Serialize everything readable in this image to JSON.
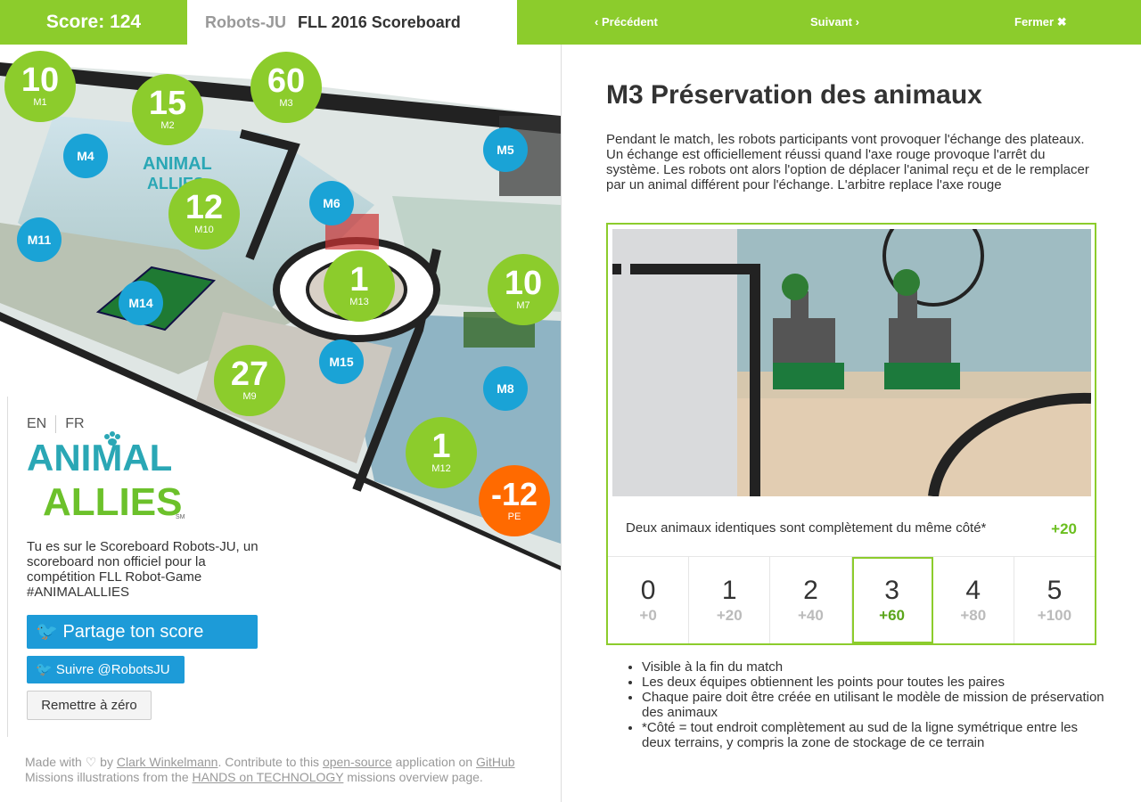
{
  "topbar": {
    "score": "Score: 124",
    "team": "Robots-JU",
    "title": "FLL 2016 Scoreboard",
    "prev": "Précédent",
    "next": "Suivant",
    "close": "Fermer"
  },
  "board": {
    "missions": [
      {
        "id": "M1",
        "value": "10",
        "state": "done"
      },
      {
        "id": "M2",
        "value": "15",
        "state": "done"
      },
      {
        "id": "M3",
        "value": "60",
        "state": "done"
      },
      {
        "id": "M4",
        "state": "todo"
      },
      {
        "id": "M5",
        "state": "todo"
      },
      {
        "id": "M6",
        "state": "todo"
      },
      {
        "id": "M7",
        "value": "10",
        "state": "done"
      },
      {
        "id": "M8",
        "state": "todo"
      },
      {
        "id": "M9",
        "value": "27",
        "state": "done"
      },
      {
        "id": "M10",
        "value": "12",
        "state": "done"
      },
      {
        "id": "M11",
        "state": "todo"
      },
      {
        "id": "M12",
        "value": "1",
        "state": "done"
      },
      {
        "id": "M13",
        "value": "1",
        "state": "done"
      },
      {
        "id": "M14",
        "state": "todo"
      },
      {
        "id": "M15",
        "state": "todo"
      },
      {
        "id": "PE",
        "value": "-12",
        "state": "penalty"
      }
    ]
  },
  "sidebar": {
    "lang_en": "EN",
    "lang_fr": "FR",
    "logo_line1": "ANIMAL",
    "logo_line2": "ALLIES",
    "logo_mark": "SM",
    "intro": "Tu es sur le Scoreboard Robots-JU, un scoreboard non officiel pour la compétition FLL Robot-Game #ANIMALALLIES",
    "share": "Partage ton score",
    "follow": "Suivre @RobotsJU",
    "reset": "Remettre à zéro"
  },
  "footer": {
    "made_with": "Made with",
    "by": "by",
    "author": "Clark Winkelmann",
    "contrib": ". Contribute to this",
    "opensource": "open-source",
    "application_on": "application on",
    "github": "GitHub",
    "missions_from": "Missions illustrations from the",
    "hands": "HANDS on TECHNOLOGY",
    "overview": "missions overview page."
  },
  "mission": {
    "title": "M3 Préservation des animaux",
    "description": "Pendant le match, les robots participants vont provoquer l'échange des plateaux. Un échange est officiellement réussi quand l'axe rouge provoque l'arrêt du système. Les robots ont alors l'option de déplacer l'animal reçu et de le remplacer par un animal différent pour l'échange. L'arbitre replace l'axe rouge",
    "objective": "Deux animaux identiques sont complètement du même côté*",
    "objective_points": "+20",
    "choices": [
      {
        "n": "0",
        "p": "+0"
      },
      {
        "n": "1",
        "p": "+20"
      },
      {
        "n": "2",
        "p": "+40"
      },
      {
        "n": "3",
        "p": "+60"
      },
      {
        "n": "4",
        "p": "+80"
      },
      {
        "n": "5",
        "p": "+100"
      }
    ],
    "selected_choice": 3,
    "rules": [
      "Visible à la fin du match",
      "Les deux équipes obtiennent les points pour toutes les paires",
      "Chaque paire doit être créée en utilisant le modèle de mission de préservation des animaux",
      "*Côté = tout endroit complètement au sud de la ligne symétrique entre les deux terrains, y compris la zone de stockage de ce terrain"
    ]
  },
  "colors": {
    "accent": "#8ccc2c",
    "todo": "#1aa3d6",
    "penalty": "#ff6a00",
    "twitter": "#1d9bd8"
  }
}
